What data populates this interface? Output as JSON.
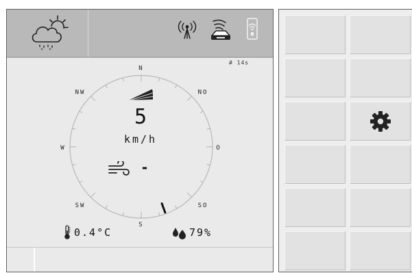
{
  "compass": {
    "directions": {
      "n": "N",
      "no": "NO",
      "o": "O",
      "so": "SO",
      "s": "S",
      "sw": "SW",
      "w": "W",
      "nw": "NW"
    },
    "wind_direction_deg": 160
  },
  "age_indicator": "# 14s",
  "speed": {
    "value": "5",
    "unit": "km/h"
  },
  "wind": {
    "value": "-"
  },
  "temperature": {
    "value": "0.4°C"
  },
  "humidity": {
    "value": "79%"
  },
  "icons": {
    "weather": "cloud-sun-rain-icon",
    "signal": "antenna-signal-icon",
    "gps": "gps-device-icon",
    "wifi": "wifi-box-icon",
    "wind": "wind-icon",
    "temperature": "thermometer-icon",
    "humidity": "water-drops-icon",
    "settings": "gear-icon"
  },
  "colors": {
    "header": "#b9b9b9",
    "panel": "#eaeaea",
    "accent": "#222222"
  }
}
